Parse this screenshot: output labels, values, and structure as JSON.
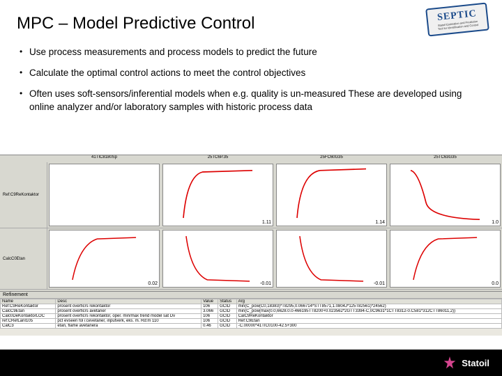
{
  "title": "MPC – Model Predictive Control",
  "stamp": {
    "main": "SEPTIC",
    "sub1": "Statoil Estimation and Prediction",
    "sub2": "Tool for Identification and Control"
  },
  "bullets": [
    "Use process measurements and process models to predict the future",
    "Calculate the optimal control actions to meet the control objectives",
    "Often uses soft-sensors/inferential models when e.g. quality is un-measured These are developed using online analyzer and/or laboratory samples with historic process data"
  ],
  "chart_titles": [
    "41TIC8180Sp",
    "25TC6P.35",
    "25FC60G35",
    "25TC63G35"
  ],
  "row_labels": [
    "Ref:C9ReKontaktor",
    "CalcC0Etan"
  ],
  "chart_vals_row1": [
    "",
    "1.11",
    "1.14",
    "1.0"
  ],
  "chart_vals_row2": [
    "0.02",
    "-0.01",
    "-0.01",
    "0.0"
  ],
  "table": {
    "title": "Refinement",
    "headers": [
      "Name",
      "Desc",
      "Value",
      "Status",
      "Arg"
    ],
    "rows": [
      [
        "Ref:C9ReKontaktor",
        "prosent overficrs rekontaktor",
        "106",
        "GCID",
        "min(C_pow(C0,18383)*T8295,0.066714*STT8571,1.0804J*125T82561)*24562)"
      ],
      [
        "CalcC9Etan",
        "prosent overficrs avetaner",
        "3.066",
        "GCID",
        "min(C_pow(max(0.0,6628.0.0-466195TT8200+0.023562*2GTT3394-C,0C9631*1CTT8312-0.C581*312CTT86011,2))"
      ],
      [
        "Calc0DeKontaktorLOC",
        "prosent overficrs rekontaktor, oper. min/max trend model sat Dv",
        "106",
        "GCID",
        "CalC9ReKontaktor"
      ],
      [
        "ref:CRefLanI105",
        "pct evseen fol i:cevetaner, inputverk, eks. m. Rd:m 110",
        "106",
        "GCID",
        "Ref:C9Etan"
      ],
      [
        "CalC3",
        "etan, flame avetanera",
        "0.46",
        "GCID",
        "-C.00000*41TIC0100-42.5+300"
      ]
    ]
  },
  "logo_text": "Statoil"
}
